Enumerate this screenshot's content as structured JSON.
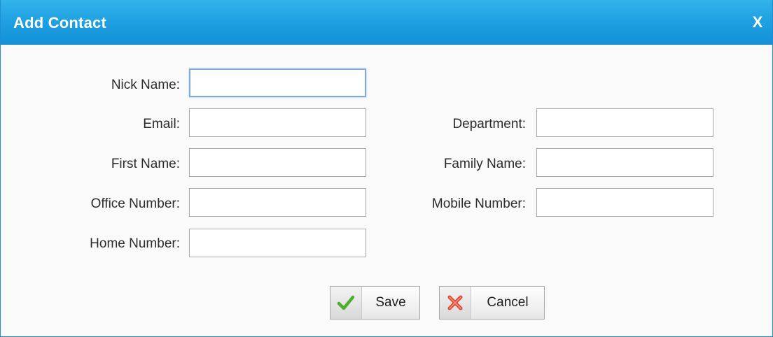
{
  "dialog": {
    "title": "Add Contact",
    "close_label": "X"
  },
  "form": {
    "nick_name": {
      "label": "Nick Name:",
      "value": ""
    },
    "email": {
      "label": "Email:",
      "value": ""
    },
    "department": {
      "label": "Department:",
      "value": ""
    },
    "first_name": {
      "label": "First Name:",
      "value": ""
    },
    "family_name": {
      "label": "Family Name:",
      "value": ""
    },
    "office_number": {
      "label": "Office Number:",
      "value": ""
    },
    "mobile_number": {
      "label": "Mobile Number:",
      "value": ""
    },
    "home_number": {
      "label": "Home Number:",
      "value": ""
    }
  },
  "buttons": {
    "save_label": "Save",
    "cancel_label": "Cancel"
  },
  "icons": {
    "save": "checkmark-icon",
    "cancel": "cross-icon"
  },
  "colors": {
    "titlebar": "#1c9ee0",
    "check": "#4caf2a",
    "cross": "#e8402a"
  }
}
